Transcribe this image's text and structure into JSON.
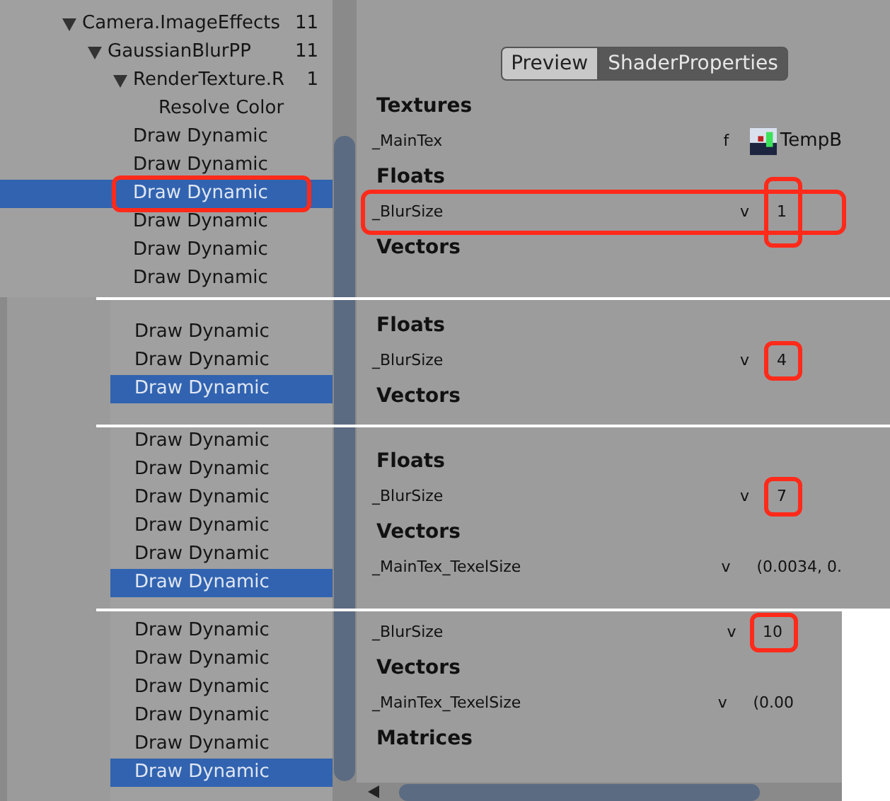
{
  "slices": [
    {
      "kind": "full",
      "tree": [
        {
          "label": "Camera.ImageEffects",
          "count": "11",
          "selected": false,
          "annotated": false,
          "expanded": true,
          "children": [
            {
              "label": "GaussianBlurPP",
              "count": "11",
              "selected": false,
              "annotated": false,
              "expanded": true,
              "children": [
                {
                  "label": "RenderTexture.R",
                  "count": "1",
                  "selected": false,
                  "annotated": false,
                  "expanded": true,
                  "children": [
                    {
                      "label": "Resolve Color",
                      "selected": false,
                      "annotated": false
                    }
                  ]
                },
                {
                  "label": "Draw Dynamic",
                  "selected": false,
                  "annotated": false
                },
                {
                  "label": "Draw Dynamic",
                  "selected": false,
                  "annotated": false
                },
                {
                  "label": "Draw Dynamic",
                  "selected": true,
                  "annotated": true
                },
                {
                  "label": "Draw Dynamic",
                  "selected": false,
                  "annotated": false
                },
                {
                  "label": "Draw Dynamic",
                  "selected": false,
                  "annotated": false
                },
                {
                  "label": "Draw Dynamic",
                  "selected": false,
                  "annotated": false
                }
              ]
            }
          ]
        }
      ],
      "tabs": [
        {
          "label": "Preview",
          "selected": false
        },
        {
          "label": "ShaderProperties",
          "selected": true
        }
      ],
      "sections": [
        {
          "title": "Textures",
          "rows": [
            {
              "name": "_MainTex",
              "type": "f",
              "value": "TempB",
              "kind": "texture",
              "row_annotated": false,
              "value_annotated": false
            }
          ]
        },
        {
          "title": "Floats",
          "rows": [
            {
              "name": "_BlurSize",
              "type": "v",
              "value": "1",
              "kind": "plain",
              "row_annotated": true,
              "value_annotated": true
            }
          ]
        },
        {
          "title": "Vectors"
        }
      ]
    },
    {
      "kind": "strip",
      "tree": [
        {
          "label": "Draw Dynamic",
          "selected": false,
          "annotated": false
        },
        {
          "label": "Draw Dynamic",
          "selected": false,
          "annotated": false
        },
        {
          "label": "Draw Dynamic",
          "selected": true,
          "annotated": false
        }
      ],
      "sections": [
        {
          "title": "Floats",
          "rows": [
            {
              "name": "_BlurSize",
              "type": "v",
              "value": "4",
              "kind": "plain",
              "row_annotated": false,
              "value_annotated": true
            }
          ]
        },
        {
          "title": "Vectors"
        }
      ]
    },
    {
      "kind": "strip",
      "tree": [
        {
          "label": "Draw Dynamic",
          "selected": false,
          "annotated": false
        },
        {
          "label": "Draw Dynamic",
          "selected": false,
          "annotated": false
        },
        {
          "label": "Draw Dynamic",
          "selected": false,
          "annotated": false
        },
        {
          "label": "Draw Dynamic",
          "selected": false,
          "annotated": false
        },
        {
          "label": "Draw Dynamic",
          "selected": false,
          "annotated": false
        },
        {
          "label": "Draw Dynamic",
          "selected": true,
          "annotated": false
        }
      ],
      "sections": [
        {
          "title": "Floats",
          "rows": [
            {
              "name": "_BlurSize",
              "type": "v",
              "value": "7",
              "kind": "plain",
              "row_annotated": false,
              "value_annotated": true
            }
          ]
        },
        {
          "title": "Vectors",
          "rows": [
            {
              "name": "_MainTex_TexelSize",
              "type": "v",
              "value": "(0.0034, 0.",
              "kind": "plain",
              "row_annotated": false,
              "value_annotated": false
            }
          ]
        }
      ]
    },
    {
      "kind": "strip",
      "tree": [
        {
          "label": "Draw Dynamic",
          "selected": false,
          "annotated": false
        },
        {
          "label": "Draw Dynamic",
          "selected": false,
          "annotated": false
        },
        {
          "label": "Draw Dynamic",
          "selected": false,
          "annotated": false
        },
        {
          "label": "Draw Dynamic",
          "selected": false,
          "annotated": false
        },
        {
          "label": "Draw Dynamic",
          "selected": false,
          "annotated": false
        },
        {
          "label": "Draw Dynamic",
          "selected": true,
          "annotated": false
        }
      ],
      "sections": [
        {
          "rows": [
            {
              "name": "_BlurSize",
              "type": "v",
              "value": "10",
              "kind": "plain",
              "row_annotated": false,
              "value_annotated": true
            }
          ]
        },
        {
          "title": "Vectors",
          "rows": [
            {
              "name": "_MainTex_TexelSize",
              "type": "v",
              "value": "(0.00",
              "kind": "plain",
              "row_annotated": false,
              "value_annotated": false
            }
          ]
        },
        {
          "title": "Matrices"
        }
      ]
    }
  ]
}
